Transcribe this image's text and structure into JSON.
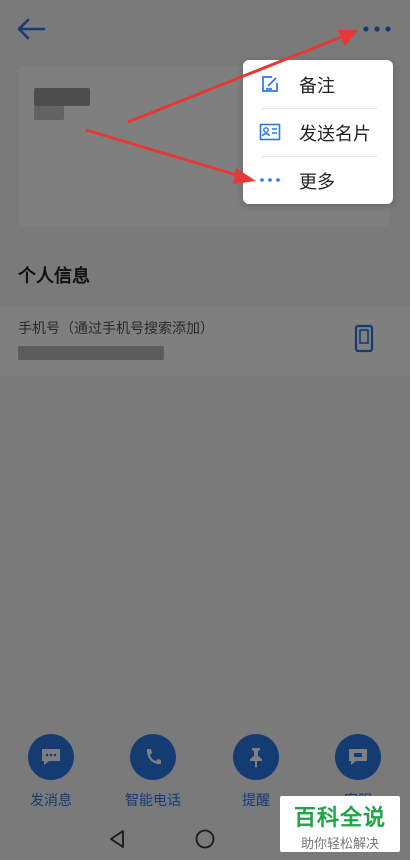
{
  "section": {
    "personal_info_title": "个人信息"
  },
  "phone": {
    "label": "手机号（通过手机号搜索添加）"
  },
  "menu": {
    "items": [
      {
        "label": "备注",
        "icon": "edit-note-icon"
      },
      {
        "label": "发送名片",
        "icon": "contact-card-icon"
      },
      {
        "label": "更多",
        "icon": "more-dots-icon"
      }
    ]
  },
  "actions": [
    {
      "label": "发消息",
      "icon": "message-icon"
    },
    {
      "label": "智能电话",
      "icon": "phone-icon"
    },
    {
      "label": "提醒",
      "icon": "pin-icon"
    },
    {
      "label": "客服",
      "icon": "service-icon"
    }
  ],
  "watermark": {
    "title": "百科全说",
    "subtitle": "助你轻松解决"
  },
  "colors": {
    "accent": "#2b78e4",
    "arrow": "#e53935",
    "watermark_green": "#21a34a"
  }
}
